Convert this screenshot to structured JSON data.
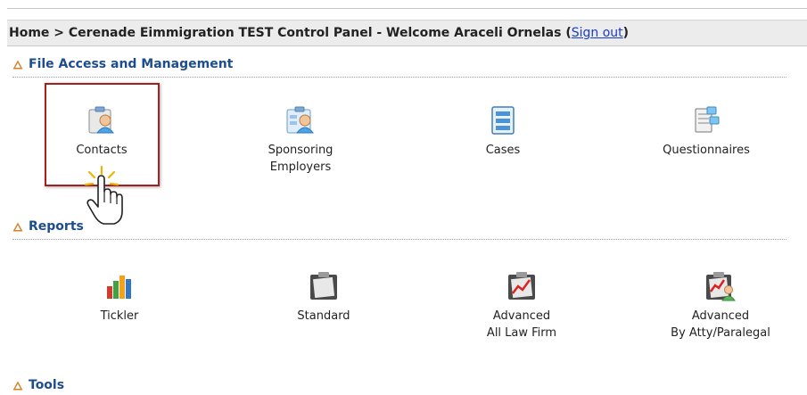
{
  "breadcrumb": {
    "text": "Home > Cerenade Eimmigration TEST Control Panel - Welcome Araceli Ornelas (",
    "sign_out": "Sign out",
    "close": ")"
  },
  "sections": {
    "file_access": {
      "title": "File Access and Management",
      "items": [
        {
          "line1": "Contacts",
          "line2": ""
        },
        {
          "line1": "Sponsoring",
          "line2": "Employers"
        },
        {
          "line1": "Cases",
          "line2": ""
        },
        {
          "line1": "Questionnaires",
          "line2": ""
        }
      ]
    },
    "reports": {
      "title": "Reports",
      "items": [
        {
          "line1": "Tickler",
          "line2": ""
        },
        {
          "line1": "Standard",
          "line2": ""
        },
        {
          "line1": "Advanced",
          "line2": "All Law Firm"
        },
        {
          "line1": "Advanced",
          "line2": "By Atty/Paralegal"
        }
      ]
    },
    "tools": {
      "title": "Tools"
    }
  },
  "colors": {
    "section_title": "#1d4d8e",
    "highlight": "#a3201f",
    "header_bg": "#ececec",
    "link": "#1a3cc9"
  }
}
